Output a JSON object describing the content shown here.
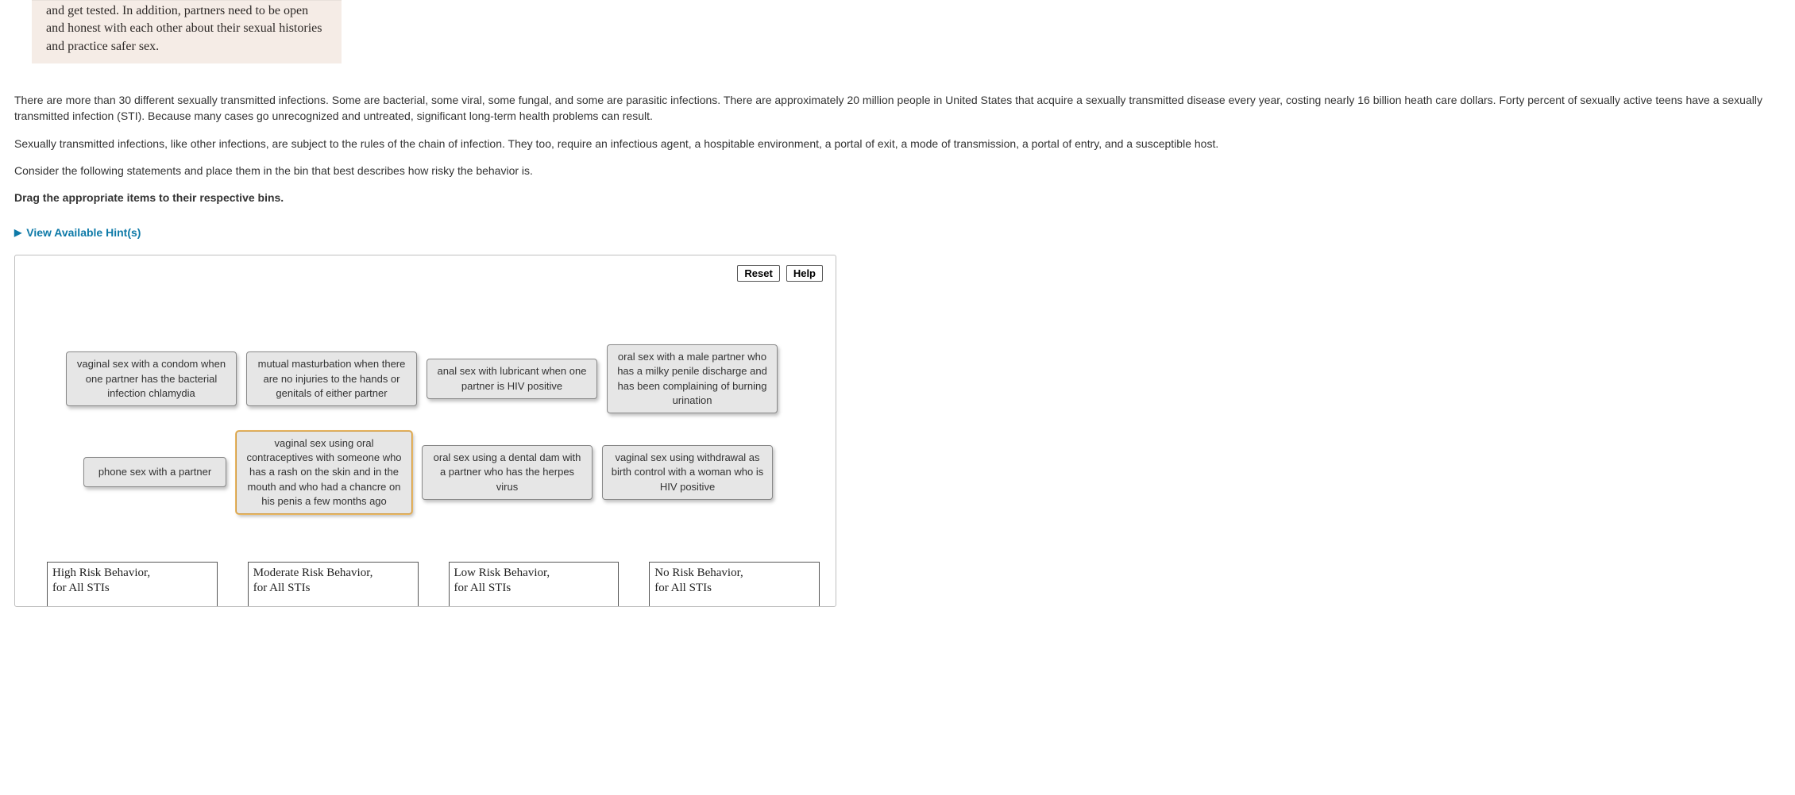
{
  "top_box": {
    "text": "and get tested. In addition, partners need to be open and honest with each other about their sexual histories and practice safer sex."
  },
  "intro": {
    "p1": "There are more than 30 different sexually transmitted infections. Some are bacterial, some viral, some fungal, and some are parasitic infections. There are approximately 20 million people in United States that acquire a sexually transmitted disease every year, costing nearly 16 billion heath care dollars. Forty percent of sexually active teens have a sexually transmitted infection (STI). Because many cases go unrecognized and untreated, significant long-term health problems can result.",
    "p2": "Sexually transmitted infections, like other infections, are subject to the rules of the chain of infection. They too, require an infectious agent, a hospitable environment, a portal of exit, a mode of transmission, a portal of entry, and a susceptible host.",
    "p3": "Consider the following statements and place them in the bin that best describes how risky the behavior is.",
    "instruction": "Drag the appropriate items to their respective bins."
  },
  "hints_label": "View Available Hint(s)",
  "buttons": {
    "reset": "Reset",
    "help": "Help"
  },
  "tiles": {
    "t1": "vaginal sex with a condom when one partner has the bacterial infection chlamydia",
    "t2": "mutual masturbation when there are no injuries to the hands or genitals of either partner",
    "t3": "anal sex with lubricant when one partner is HIV positive",
    "t4": "oral sex with a male partner who has a milky penile discharge and has been complaining of burning urination",
    "t5": "phone sex with a partner",
    "t6": "vaginal sex using oral contraceptives with someone who has a rash on the skin and in the mouth and who had a chancre on his penis a few months ago",
    "t7": "oral sex using a dental dam with a partner who has the herpes virus",
    "t8": "vaginal sex using withdrawal as birth control with a woman who is HIV positive"
  },
  "bins": {
    "b1": {
      "line1": "High Risk Behavior,",
      "line2": "for All STIs"
    },
    "b2": {
      "line1": "Moderate Risk Behavior,",
      "line2": "for All STIs"
    },
    "b3": {
      "line1": "Low Risk Behavior,",
      "line2": "for All STIs"
    },
    "b4": {
      "line1": "No Risk Behavior,",
      "line2": "for All STIs"
    }
  }
}
